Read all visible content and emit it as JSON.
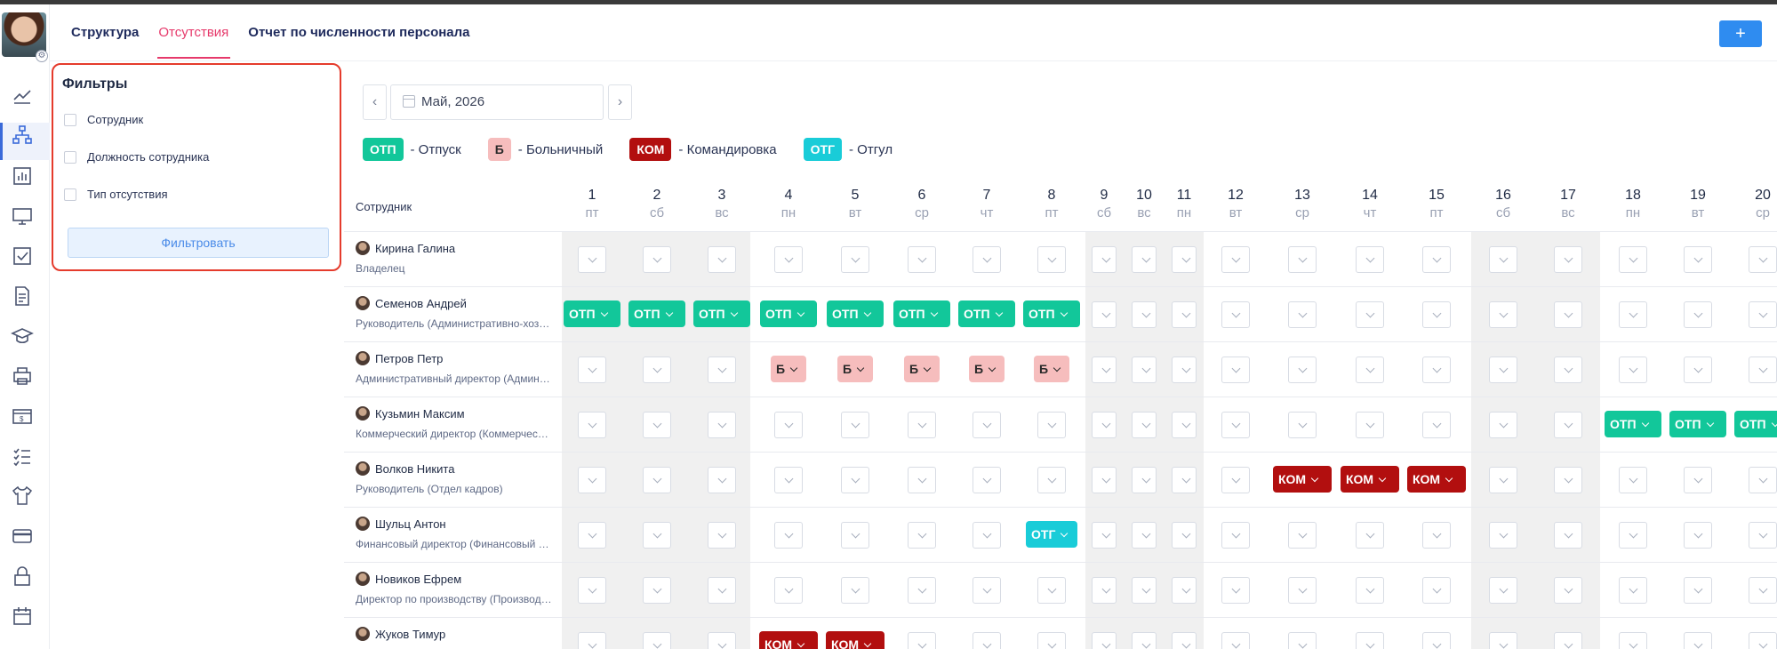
{
  "nav": {
    "tabs": [
      "Структура",
      "Отсутствия",
      "Отчет по численности персонала"
    ],
    "active": 1
  },
  "header": {
    "add_label": "+"
  },
  "sidebar_icons": [
    "handshake-icon",
    "org-structure-icon",
    "bar-chart-icon",
    "monitor-icon",
    "checkbox-icon",
    "document-icon",
    "graduation-cap-icon",
    "printer-icon",
    "money-icon",
    "checklist-icon",
    "tshirt-icon",
    "credit-card-icon",
    "lock-icon",
    "calendar-icon"
  ],
  "filters": {
    "title": "Фильтры",
    "items": [
      "Сотрудник",
      "Должность сотрудника",
      "Тип отсутствия"
    ],
    "button": "Фильтровать"
  },
  "month_picker": {
    "value": "Май, 2026",
    "prev": "‹",
    "next": "›"
  },
  "legend": [
    {
      "code": "ОТП",
      "label": "- Отпуск",
      "type": "otp"
    },
    {
      "code": "Б",
      "label": "- Больничный",
      "type": "b"
    },
    {
      "code": "КОМ",
      "label": "- Командировка",
      "type": "kom"
    },
    {
      "code": "ОТГ",
      "label": "- Отгул",
      "type": "otg"
    }
  ],
  "colors": {
    "otp": "#12c79a",
    "b": "#f6bdbd",
    "kom": "#b20f0f",
    "otg": "#19ccd8",
    "accent": "#e6396b",
    "primary": "#2f8cf0"
  },
  "grid": {
    "employee_header": "Сотрудник",
    "days": [
      {
        "n": "1",
        "w": "пт"
      },
      {
        "n": "2",
        "w": "сб"
      },
      {
        "n": "3",
        "w": "вс"
      },
      {
        "n": "4",
        "w": "пн"
      },
      {
        "n": "5",
        "w": "вт"
      },
      {
        "n": "6",
        "w": "ср"
      },
      {
        "n": "7",
        "w": "чт"
      },
      {
        "n": "8",
        "w": "пт"
      },
      {
        "n": "9",
        "w": "сб"
      },
      {
        "n": "10",
        "w": "вс"
      },
      {
        "n": "11",
        "w": "пн"
      },
      {
        "n": "12",
        "w": "вт"
      },
      {
        "n": "13",
        "w": "ср"
      },
      {
        "n": "14",
        "w": "чт"
      },
      {
        "n": "15",
        "w": "пт"
      },
      {
        "n": "16",
        "w": "сб"
      },
      {
        "n": "17",
        "w": "вс"
      },
      {
        "n": "18",
        "w": "пн"
      },
      {
        "n": "19",
        "w": "вт"
      },
      {
        "n": "20",
        "w": "ср"
      }
    ],
    "employees": [
      {
        "name": "Кирина Галина",
        "position": "Владелец",
        "absences": {}
      },
      {
        "name": "Семенов Андрей",
        "position": "Руководитель (Административно-хоз…",
        "absences": {
          "1": "otp",
          "2": "otp",
          "3": "otp",
          "4": "otp",
          "5": "otp",
          "6": "otp",
          "7": "otp",
          "8": "otp"
        }
      },
      {
        "name": "Петров Петр",
        "position": "Административный директор (Админ…",
        "absences": {
          "4": "b",
          "5": "b",
          "6": "b",
          "7": "b",
          "8": "b"
        }
      },
      {
        "name": "Кузьмин Максим",
        "position": "Коммерческий директор (Коммерчес…",
        "absences": {
          "18": "otp",
          "19": "otp",
          "20": "otp"
        }
      },
      {
        "name": "Волков Никита",
        "position": "Руководитель (Отдел кадров)",
        "absences": {
          "13": "kom",
          "14": "kom",
          "15": "kom"
        }
      },
      {
        "name": "Шульц Антон",
        "position": "Финансовый директор (Финансовый …",
        "absences": {
          "8": "otg"
        }
      },
      {
        "name": "Новиков Ефрем",
        "position": "Директор по производству (Производ…",
        "absences": {}
      },
      {
        "name": "Жуков Тимур",
        "position": "",
        "absences": {
          "4": "kom",
          "5": "kom"
        }
      }
    ]
  }
}
